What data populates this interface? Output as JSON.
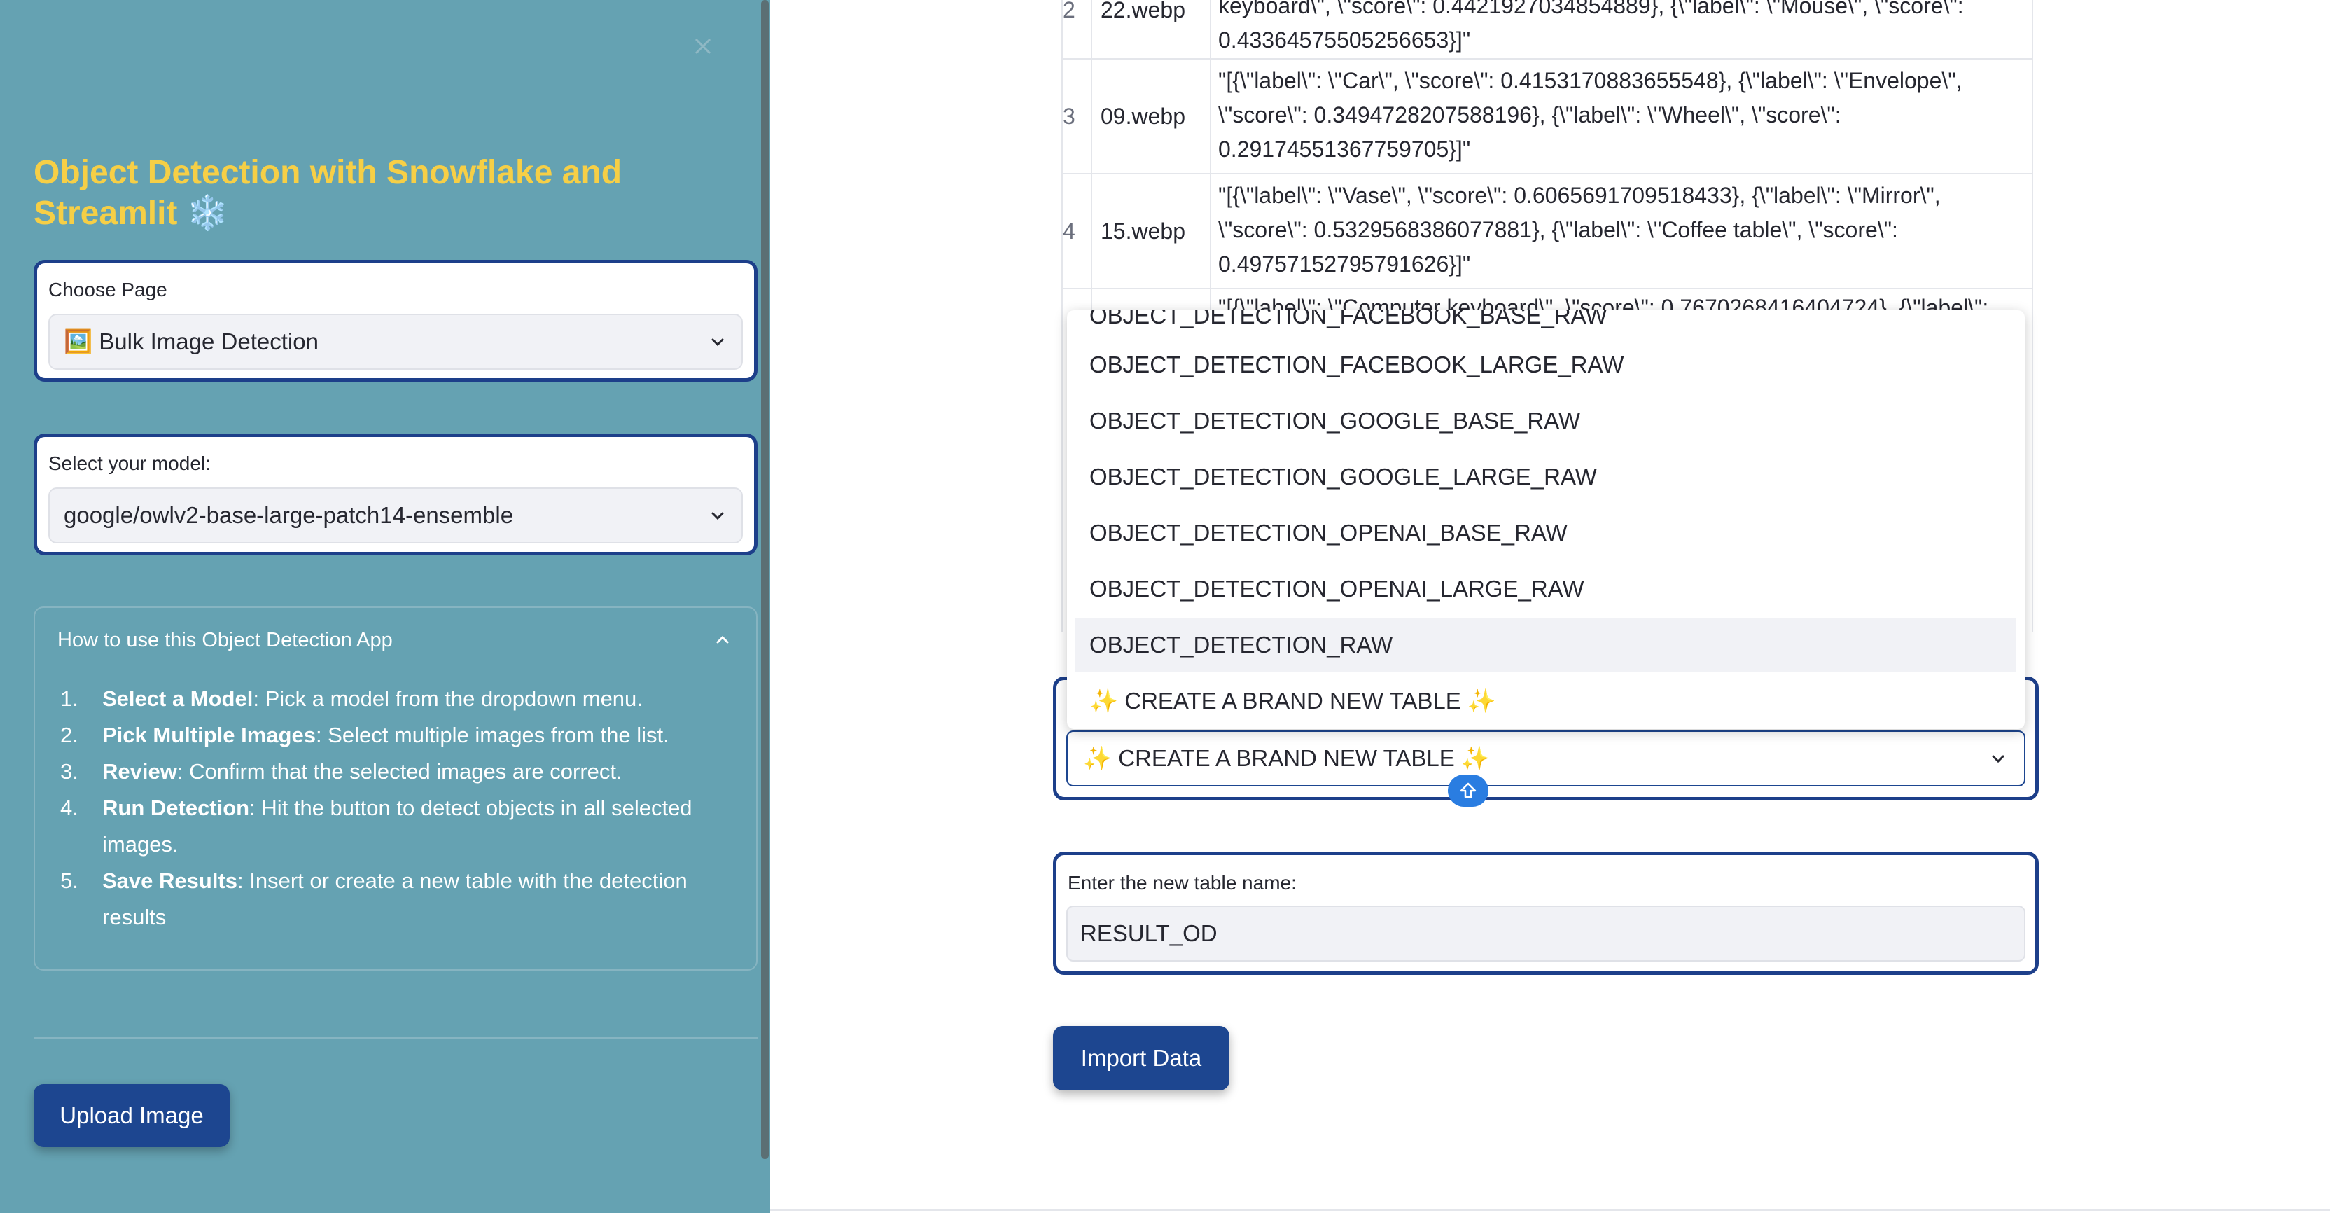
{
  "sidebar": {
    "title": "Object Detection with Snowflake and Streamlit ❄️",
    "page_select": {
      "label": "Choose Page",
      "value": "🖼️ Bulk Image Detection"
    },
    "model_select": {
      "label": "Select your model:",
      "value": "google/owlv2-base-large-patch14-ensemble"
    },
    "howto": {
      "title": "How to use this Object Detection App",
      "steps": [
        {
          "num": "1.",
          "bold": "Select a Model",
          "text": ": Pick a model from the dropdown menu."
        },
        {
          "num": "2.",
          "bold": "Pick Multiple Images",
          "text": ": Select multiple images from the list."
        },
        {
          "num": "3.",
          "bold": "Review",
          "text": ": Confirm that the selected images are correct."
        },
        {
          "num": "4.",
          "bold": "Run Detection",
          "text": ": Hit the button to detect objects in all selected images."
        },
        {
          "num": "5.",
          "bold": "Save Results",
          "text": ": Insert or create a new table with the detection results"
        }
      ]
    },
    "upload_button": "Upload Image",
    "close_icon": "close-icon"
  },
  "table": {
    "rows": [
      {
        "idx": "2",
        "name": "22.webp",
        "value": "keyboard\\\", \\\"score\\\": 0.4421927034854889}, {\\\"label\\\": \\\"Mouse\\\", \\\"score\\\": 0.43364575505256653}]\""
      },
      {
        "idx": "3",
        "name": "09.webp",
        "value": "\"[{\\\"label\\\": \\\"Car\\\", \\\"score\\\": 0.4153170883655548}, {\\\"label\\\": \\\"Envelope\\\", \\\"score\\\": 0.3494728207588196}, {\\\"label\\\": \\\"Wheel\\\", \\\"score\\\": 0.29174551367759705}]\""
      },
      {
        "idx": "4",
        "name": "15.webp",
        "value": "\"[{\\\"label\\\": \\\"Vase\\\", \\\"score\\\": 0.6065691709518433}, {\\\"label\\\": \\\"Mirror\\\", \\\"score\\\": 0.5329568386077881}, {\\\"label\\\": \\\"Coffee table\\\", \\\"score\\\": 0.49757152795791626}]\""
      },
      {
        "idx": "",
        "name": "",
        "value": "\"[{\\\"label\\\": \\\"Computer keyboard\\\", \\\"score\\\": 0.7670268416404724}, {\\\"label\\\":"
      }
    ]
  },
  "dropdown": {
    "partial_item": "OBJECT_DETECTION_FACEBOOK_BASE_RAW",
    "items": [
      "OBJECT_DETECTION_FACEBOOK_LARGE_RAW",
      "OBJECT_DETECTION_GOOGLE_BASE_RAW",
      "OBJECT_DETECTION_GOOGLE_LARGE_RAW",
      "OBJECT_DETECTION_OPENAI_BASE_RAW",
      "OBJECT_DETECTION_OPENAI_LARGE_RAW",
      "OBJECT_DETECTION_RAW",
      "✨ CREATE A BRAND NEW TABLE ✨"
    ],
    "highlighted_index": 5
  },
  "table_select": {
    "value": "✨ CREATE A BRAND NEW TABLE ✨"
  },
  "new_table": {
    "label": "Enter the new table name:",
    "value": "RESULT_OD"
  },
  "import_button": "Import Data",
  "colors": {
    "sidebar_bg": "#65a2b2",
    "title": "#f6cf46",
    "accent": "#1d4690",
    "panel_border": "#1d3f8a"
  }
}
